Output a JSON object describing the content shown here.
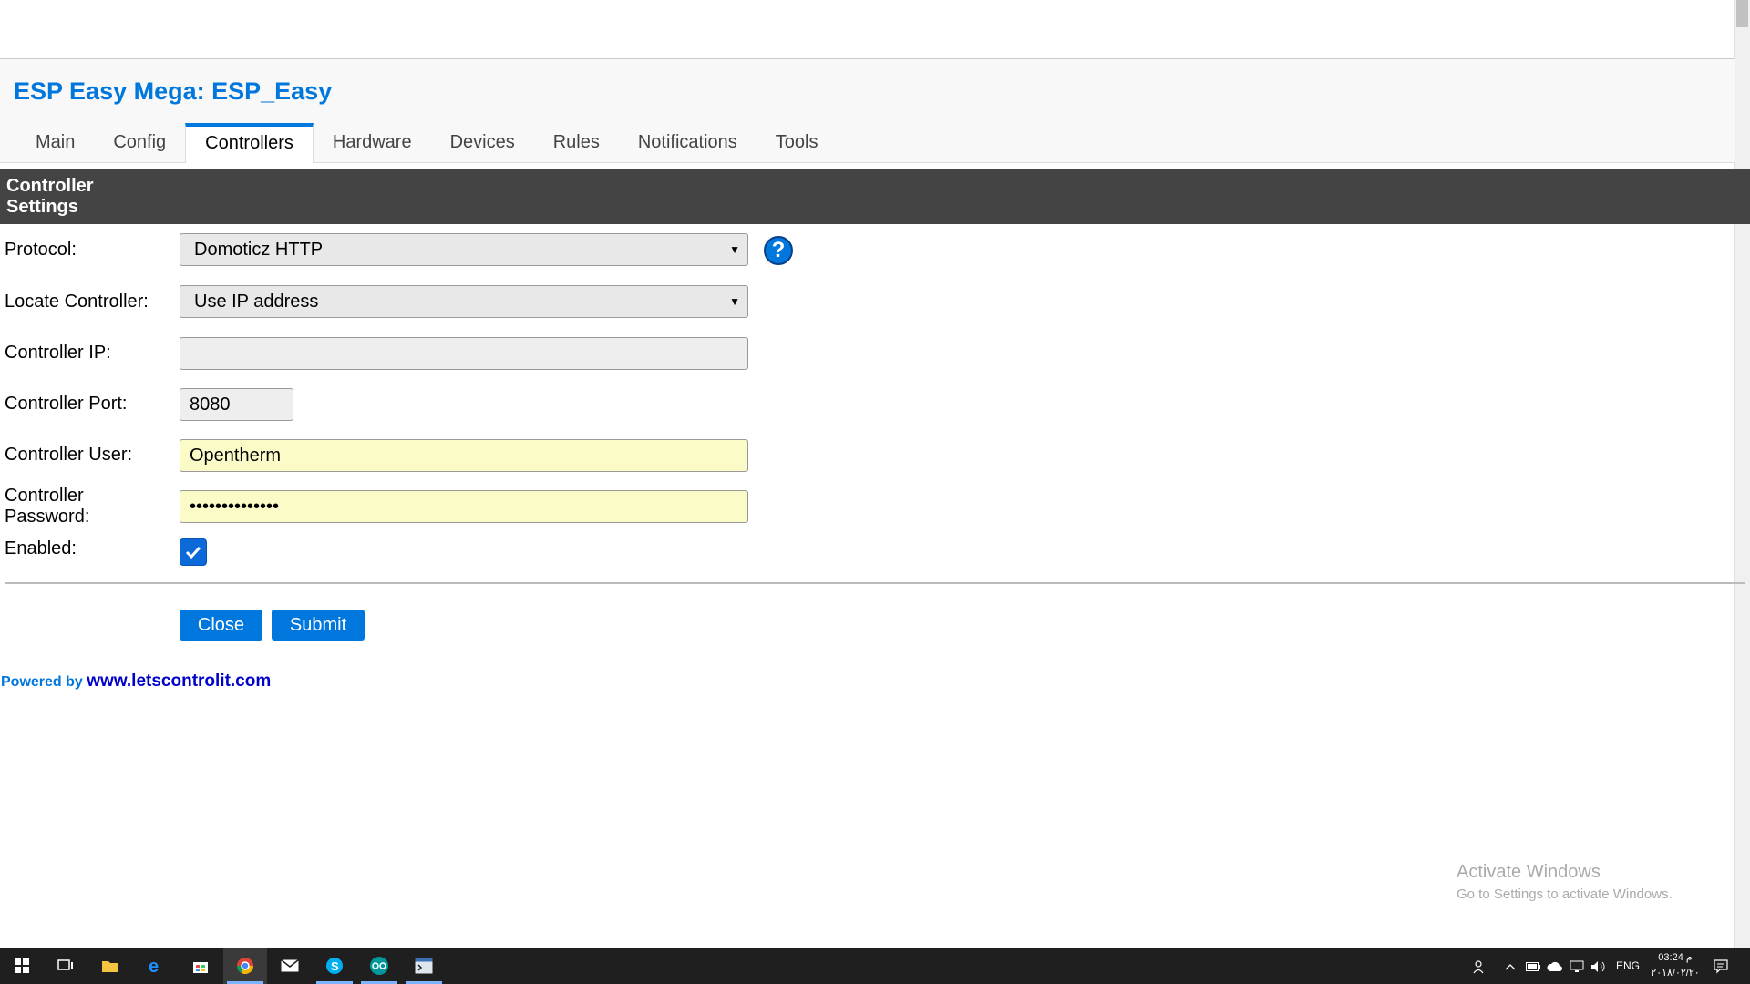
{
  "site_title": "ESP Easy Mega: ESP_Easy",
  "tabs": [
    "Main",
    "Config",
    "Controllers",
    "Hardware",
    "Devices",
    "Rules",
    "Notifications",
    "Tools"
  ],
  "active_tab": "Controllers",
  "section_title": "Controller Settings",
  "form": {
    "protocol": {
      "label": "Protocol:",
      "value": "Domoticz HTTP"
    },
    "locate": {
      "label": "Locate Controller:",
      "value": "Use IP address"
    },
    "ip": {
      "label": "Controller IP:",
      "value": ""
    },
    "port": {
      "label": "Controller Port:",
      "value": "8080"
    },
    "user": {
      "label": "Controller User:",
      "value": "Opentherm"
    },
    "password": {
      "label": "Controller Password:",
      "value": "••••••••••••••"
    },
    "enabled": {
      "label": "Enabled:",
      "checked": true
    }
  },
  "buttons": {
    "close": "Close",
    "submit": "Submit"
  },
  "footer": {
    "powered_by": "Powered by",
    "link": "www.letscontrolit.com"
  },
  "watermark": {
    "title": "Activate Windows",
    "subtitle": "Go to Settings to activate Windows."
  },
  "taskbar": {
    "apps": [
      "windows-start-icon",
      "task-view-icon",
      "file-explorer-icon",
      "edge-icon",
      "store-icon",
      "chrome-icon",
      "mail-icon",
      "skype-icon",
      "arduino-icon",
      "terminal-icon"
    ],
    "language": "ENG",
    "time": "03:24 م",
    "date": "٢٠١٨/٠٢/٢٠"
  },
  "colors": {
    "accent": "#0077DD",
    "section_bar": "#444444",
    "taskbar": "#1f1f1f"
  }
}
